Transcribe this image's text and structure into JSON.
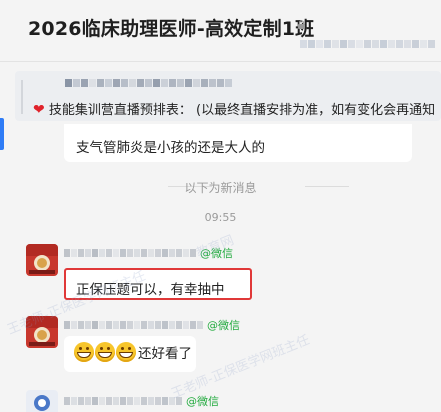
{
  "header": {
    "title": "2026临床助理医师-高效定制1班"
  },
  "pinned_quote": {
    "text": "技能集训营直播预排表： (以最终直播安排为准，如有变化会再通知"
  },
  "messages": [
    {
      "id": "m1",
      "text": "支气管肺炎是小孩的还是大人的"
    }
  ],
  "divider": {
    "label": "以下为新消息",
    "time": "09:55"
  },
  "chat": [
    {
      "sender_tag": "@微信",
      "text": "正保压题可以，有幸抽中",
      "highlighted": true
    },
    {
      "sender_tag": "@微信",
      "text": "还好看了",
      "emoji_count": 3
    },
    {
      "sender_tag": "@微信"
    }
  ],
  "watermark": {
    "text": "王老师-正保医学网班主任",
    "text2": "教育网",
    "text3": "王老师-正保医学网班主任"
  },
  "colors": {
    "accent": "#2f7cf6",
    "wechat_tag": "#22aa3e",
    "highlight_border": "#e03838"
  }
}
